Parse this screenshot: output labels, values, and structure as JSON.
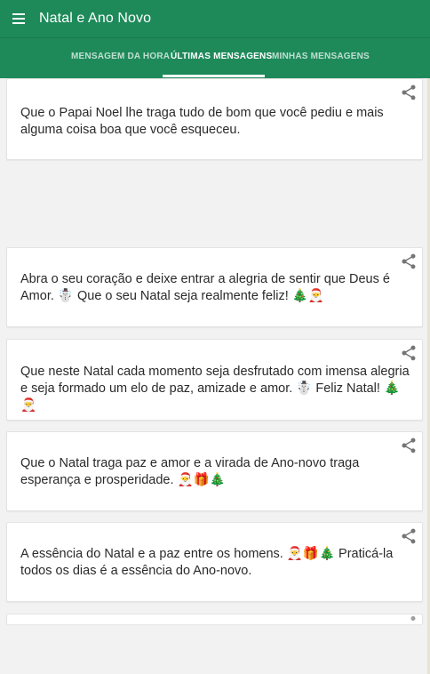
{
  "app": {
    "title": "Natal e Ano Novo"
  },
  "tabs": [
    {
      "label": "MENSAGEM DA HORA",
      "active": false
    },
    {
      "label": "ÚLTIMAS MENSAGENS",
      "active": true
    },
    {
      "label": "MINHAS MENSAGENS",
      "active": false
    }
  ],
  "messages": [
    {
      "text": "Que o Papai Noel lhe traga tudo de bom que você pediu e mais alguma coisa boa que você esqueceu."
    },
    {
      "text": "Abra o seu coração e deixe entrar a alegria de sentir que Deus é Amor. ☃️ Que o seu Natal seja realmente feliz! 🎄🎅"
    },
    {
      "text": "Que neste Natal cada momento seja desfrutado com imensa alegria e seja formado um elo de paz, amizade e amor. ☃️ Feliz Natal! 🎄🎅"
    },
    {
      "text": "Que o Natal traga paz e amor e a virada de Ano-novo traga esperança e prosperidade. 🎅🎁🎄"
    },
    {
      "text": "A essência do Natal e a paz entre os homens. 🎅🎁🎄 Praticá-la todos os dias é a essência do Ano-novo."
    }
  ],
  "colors": {
    "appbar": "#1e8a5a",
    "background": "#f2f2f2"
  },
  "icons": {
    "menu": "menu-icon",
    "share": "share-icon"
  }
}
